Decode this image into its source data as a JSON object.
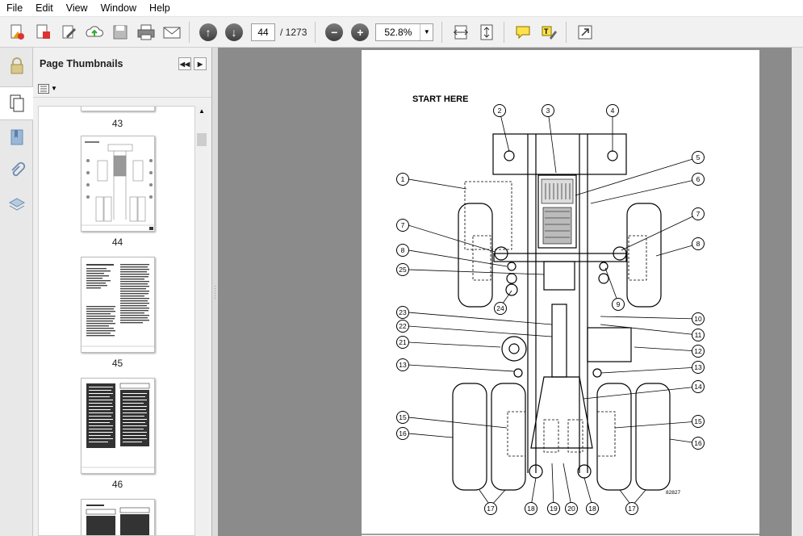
{
  "menu": [
    "File",
    "Edit",
    "View",
    "Window",
    "Help"
  ],
  "toolbar": {
    "icons": [
      "create-pdf-icon",
      "convert-icon",
      "edit-icon",
      "upload-icon",
      "save-icon",
      "print-icon",
      "email-icon"
    ],
    "current_page": "44",
    "page_count": "/ 1273",
    "zoom": "52.8%"
  },
  "panel": {
    "title": "Page Thumbnails",
    "thumbnails": [
      {
        "label": "43"
      },
      {
        "label": "44"
      },
      {
        "label": "45"
      },
      {
        "label": "46"
      }
    ]
  },
  "document": {
    "heading": "START HERE",
    "figure_id": "82827",
    "callouts": [
      "1",
      "2",
      "3",
      "4",
      "5",
      "6",
      "7",
      "7",
      "8",
      "8",
      "9",
      "10",
      "11",
      "12",
      "13",
      "13",
      "14",
      "15",
      "15",
      "16",
      "16",
      "17",
      "17",
      "18",
      "18",
      "19",
      "20",
      "21",
      "22",
      "23",
      "24",
      "25"
    ]
  }
}
